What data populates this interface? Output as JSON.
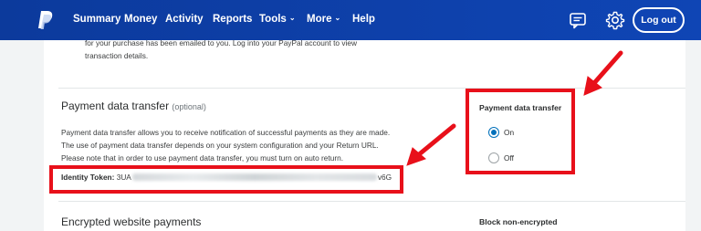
{
  "nav": {
    "items": [
      {
        "label": "Summary"
      },
      {
        "label": "Money"
      },
      {
        "label": "Activity"
      },
      {
        "label": "Reports"
      },
      {
        "label": "Tools",
        "dropdown": true
      },
      {
        "label": "More",
        "dropdown": true
      },
      {
        "label": "Help"
      }
    ],
    "logout_label": "Log out",
    "icons": [
      "paypal-logo",
      "message-icon",
      "settings-gear-icon"
    ]
  },
  "content": {
    "intro_line1": "for your purchase has been emailed to you. Log into your PayPal account to view",
    "intro_line2": "transaction details.",
    "pdt": {
      "title": "Payment data transfer",
      "optional": "(optional)",
      "desc_line1": "Payment data transfer allows you to receive notification of successful payments as they are made.",
      "desc_line2": "The use of payment data transfer depends on your system configuration and your Return URL.",
      "desc_line3": "Please note that in order to use payment data transfer, you must turn on auto return.",
      "token_label": "Identity Token:",
      "token_prefix": "3UA",
      "token_suffix": "v6G"
    },
    "pdt_setting": {
      "title": "Payment data transfer",
      "options": [
        {
          "label": "On",
          "selected": true
        },
        {
          "label": "Off",
          "selected": false
        }
      ]
    },
    "ewp": {
      "title": "Encrypted website payments",
      "right_title": "Block non-encrypted"
    }
  },
  "colors": {
    "nav_bg": "#0f3c9f",
    "highlight": "#e8101a",
    "radio_accent": "#0070ba"
  }
}
